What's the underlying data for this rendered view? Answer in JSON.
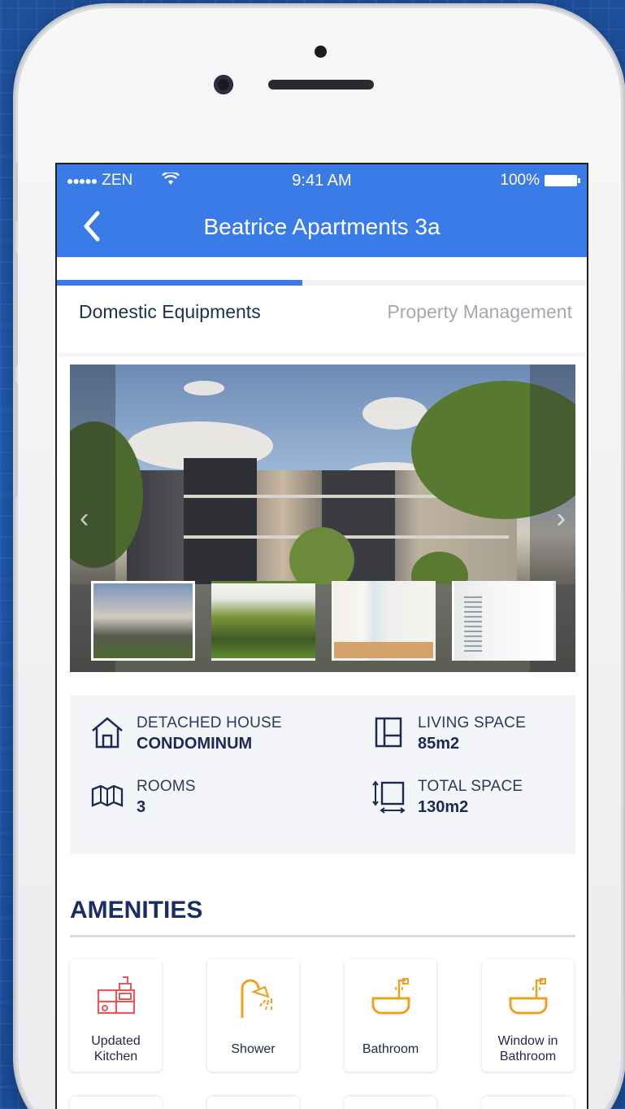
{
  "status_bar": {
    "carrier": "ZEN",
    "time": "9:41 AM",
    "battery": "100%"
  },
  "nav": {
    "back_icon": "chevron-left-icon",
    "title": "Beatrice Apartments 3a"
  },
  "tabs": [
    {
      "label": "Domestic Equipments",
      "active": true
    },
    {
      "label": "Property Management",
      "active": false
    }
  ],
  "gallery": {
    "thumbnails": [
      "exterior",
      "garden",
      "hallway",
      "bathroom"
    ],
    "selected_index": 0
  },
  "details": {
    "type_label": "DETACHED HOUSE",
    "type_value": "CONDOMINUM",
    "living_label": "LIVING SPACE",
    "living_value": "85m2",
    "rooms_label": "ROOMS",
    "rooms_value": "3",
    "total_label": "TOTAL SPACE",
    "total_value": "130m2"
  },
  "amenities": {
    "title": "AMENITIES",
    "items": [
      {
        "label": "Updated Kitchen",
        "icon": "kitchen-icon",
        "color": "#e45a5a"
      },
      {
        "label": "Shower",
        "icon": "shower-icon",
        "color": "#f0a020"
      },
      {
        "label": "Bathroom",
        "icon": "bathtub-icon",
        "color": "#f0a020"
      },
      {
        "label": "Window in Bathroom",
        "icon": "bathtub-icon",
        "color": "#f0a020"
      }
    ]
  },
  "colors": {
    "accent": "#3b7be8",
    "title_navy": "#1a2e63"
  }
}
